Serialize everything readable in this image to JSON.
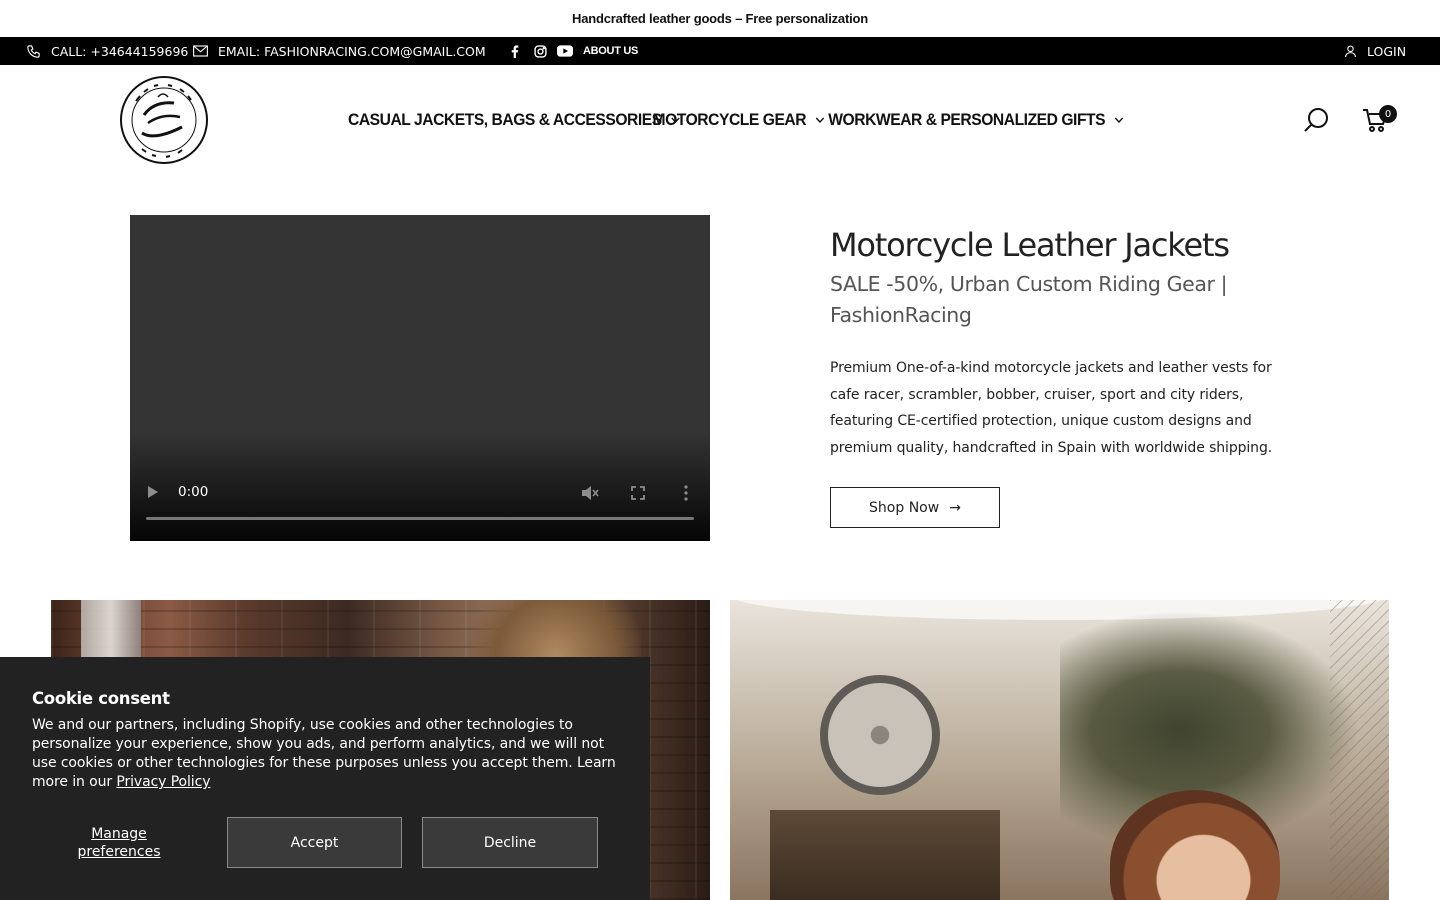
{
  "announcement": "Handcrafted leather goods – Free personalization",
  "topbar": {
    "call": "CALL: +34644159696",
    "email": "EMAIL: FASHIONRACING.COM@GMAIL.COM",
    "about": "ABOUT US",
    "login": "LOGIN",
    "social_icons": [
      "facebook-icon",
      "instagram-icon",
      "youtube-icon"
    ]
  },
  "nav": {
    "items": [
      {
        "label": "CASUAL JACKETS, BAGS & ACCESSORIES"
      },
      {
        "label": "MOTORCYCLE GEAR"
      },
      {
        "label": "WORKWEAR & PERSONALIZED GIFTS"
      }
    ],
    "cart_count": "0"
  },
  "hero": {
    "title": "Motorcycle Leather Jackets",
    "subtitle": "SALE -50%, Urban Custom Riding Gear | FashionRacing",
    "description": "Premium One-of-a-kind motorcycle jackets and leather vests for cafe racer, scrambler, bobber, cruiser, sport and city riders, featuring CE-certified protection, unique custom designs and premium quality, handcrafted in Spain with worldwide shipping.",
    "cta": "Shop Now",
    "video_time": "0:00"
  },
  "cookie": {
    "title": "Cookie consent",
    "text": "We and our partners, including Shopify, use cookies and other technologies to personalize your experience, show you ads, and perform analytics, and we will not use cookies or other technologies for these purposes unless you accept them. Learn more in our ",
    "link": "Privacy Policy",
    "manage": "Manage preferences",
    "accept": "Accept",
    "decline": "Decline"
  },
  "colors": {
    "topbar_bg": "#000000",
    "cookie_bg": "#222222",
    "video_bg": "#343434"
  }
}
